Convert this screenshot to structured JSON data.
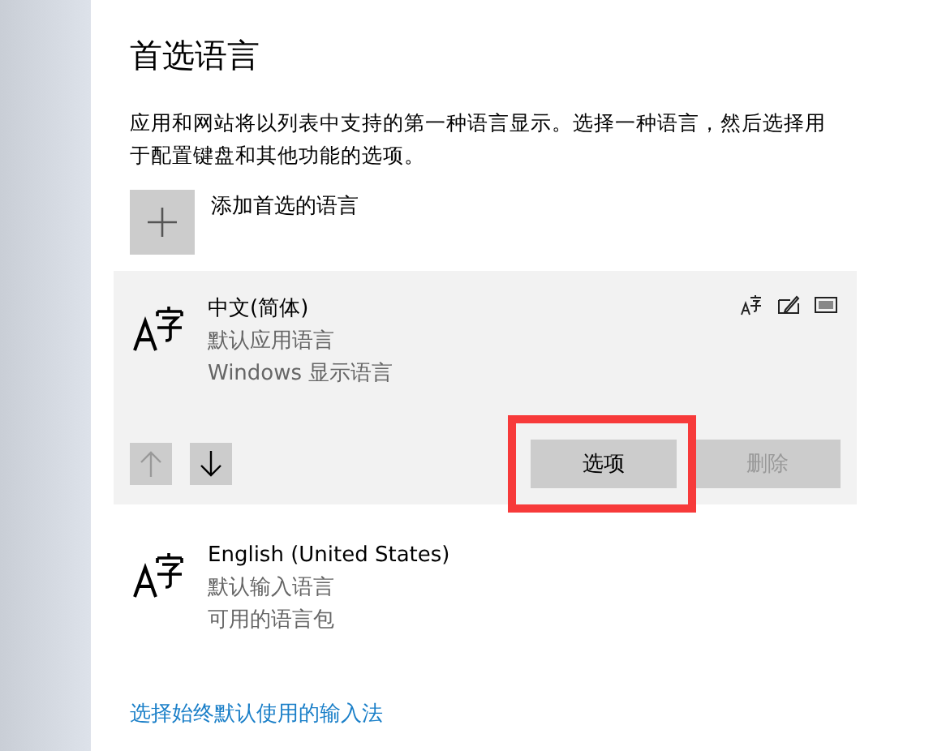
{
  "title": "首选语言",
  "description": "应用和网站将以列表中支持的第一种语言显示。选择一种语言，然后选择用于配置键盘和其他功能的选项。",
  "add_button": {
    "label": "添加首选的语言"
  },
  "languages": [
    {
      "name": "中文(简体)",
      "details": [
        "默认应用语言",
        "Windows 显示语言"
      ],
      "selected": true,
      "move_up_disabled": true,
      "move_down_disabled": false,
      "options": {
        "label": "选项",
        "highlighted": true
      },
      "remove": {
        "label": "删除",
        "disabled": true
      }
    },
    {
      "name": "English (United States)",
      "details": [
        "默认输入语言",
        "可用的语言包"
      ],
      "selected": false
    }
  ],
  "link": "选择始终默认使用的输入法"
}
